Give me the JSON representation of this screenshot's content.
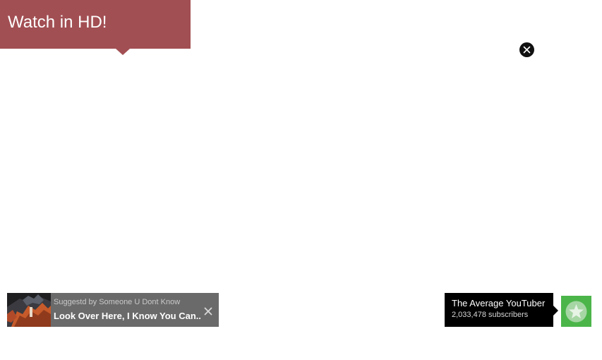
{
  "annotation": {
    "text": "Watch in HD!",
    "color": "#a24f53"
  },
  "close_button": {
    "icon": "close-icon"
  },
  "suggestion": {
    "by_label": "Suggestd by Someone U Dont Know",
    "title": "Look Over Here, I Know You Can...",
    "dismiss_icon": "close-icon",
    "thumbnail_icon": "video-thumbnail"
  },
  "channel": {
    "name": "The Average YouTuber",
    "subscribers": "2,033,478 subscribers",
    "avatar_icon": "channel-avatar-icon",
    "avatar_color": "#4bb54a"
  }
}
